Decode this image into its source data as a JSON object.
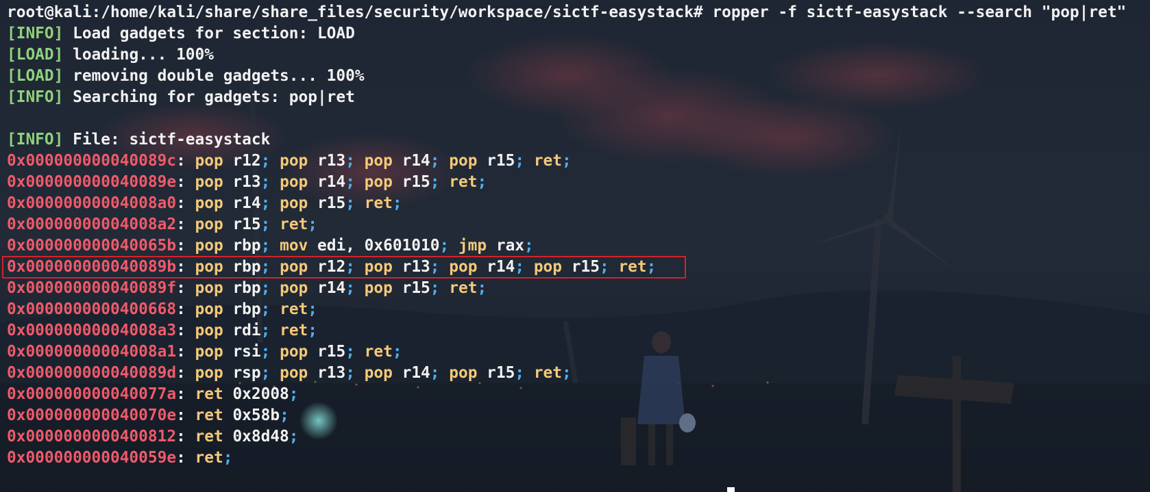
{
  "terminal": {
    "prompt": "root@kali:/home/kali/share/share_files/security/workspace/sictf-easystack#",
    "command": "ropper -f sictf-easystack --search \"pop|ret\"",
    "log": [
      {
        "tag": "[INFO]",
        "message": "Load gadgets for section: LOAD"
      },
      {
        "tag": "[LOAD]",
        "message": "loading... 100%"
      },
      {
        "tag": "[LOAD]",
        "message": "removing double gadgets... 100%"
      },
      {
        "tag": "[INFO]",
        "message": "Searching for gadgets: pop|ret"
      }
    ],
    "file_info": {
      "tag": "[INFO]",
      "message": "File: sictf-easystack"
    },
    "gadgets": [
      {
        "addr": "0x000000000040089c",
        "instrs": [
          [
            "pop",
            "r12"
          ],
          [
            "pop",
            "r13"
          ],
          [
            "pop",
            "r14"
          ],
          [
            "pop",
            "r15"
          ],
          [
            "ret",
            ""
          ]
        ]
      },
      {
        "addr": "0x000000000040089e",
        "instrs": [
          [
            "pop",
            "r13"
          ],
          [
            "pop",
            "r14"
          ],
          [
            "pop",
            "r15"
          ],
          [
            "ret",
            ""
          ]
        ]
      },
      {
        "addr": "0x00000000004008a0",
        "instrs": [
          [
            "pop",
            "r14"
          ],
          [
            "pop",
            "r15"
          ],
          [
            "ret",
            ""
          ]
        ]
      },
      {
        "addr": "0x00000000004008a2",
        "instrs": [
          [
            "pop",
            "r15"
          ],
          [
            "ret",
            ""
          ]
        ]
      },
      {
        "addr": "0x000000000040065b",
        "instrs": [
          [
            "pop",
            "rbp"
          ],
          [
            "mov",
            "edi, 0x601010"
          ],
          [
            "jmp",
            "rax"
          ]
        ]
      },
      {
        "addr": "0x000000000040089b",
        "instrs": [
          [
            "pop",
            "rbp"
          ],
          [
            "pop",
            "r12"
          ],
          [
            "pop",
            "r13"
          ],
          [
            "pop",
            "r14"
          ],
          [
            "pop",
            "r15"
          ],
          [
            "ret",
            ""
          ]
        ]
      },
      {
        "addr": "0x000000000040089f",
        "instrs": [
          [
            "pop",
            "rbp"
          ],
          [
            "pop",
            "r14"
          ],
          [
            "pop",
            "r15"
          ],
          [
            "ret",
            ""
          ]
        ]
      },
      {
        "addr": "0x0000000000400668",
        "instrs": [
          [
            "pop",
            "rbp"
          ],
          [
            "ret",
            ""
          ]
        ]
      },
      {
        "addr": "0x00000000004008a3",
        "instrs": [
          [
            "pop",
            "rdi"
          ],
          [
            "ret",
            ""
          ]
        ]
      },
      {
        "addr": "0x00000000004008a1",
        "instrs": [
          [
            "pop",
            "rsi"
          ],
          [
            "pop",
            "r15"
          ],
          [
            "ret",
            ""
          ]
        ]
      },
      {
        "addr": "0x000000000040089d",
        "instrs": [
          [
            "pop",
            "rsp"
          ],
          [
            "pop",
            "r13"
          ],
          [
            "pop",
            "r14"
          ],
          [
            "pop",
            "r15"
          ],
          [
            "ret",
            ""
          ]
        ]
      },
      {
        "addr": "0x000000000040077a",
        "instrs": [
          [
            "ret",
            "0x2008"
          ]
        ]
      },
      {
        "addr": "0x000000000040070e",
        "instrs": [
          [
            "ret",
            "0x58b"
          ]
        ]
      },
      {
        "addr": "0x0000000000400812",
        "instrs": [
          [
            "ret",
            "0x8d48"
          ]
        ]
      },
      {
        "addr": "0x000000000040059e",
        "instrs": [
          [
            "ret",
            ""
          ]
        ]
      }
    ],
    "highlighted_gadget_index": 5
  },
  "colors": {
    "tag": "#8fd17c",
    "address": "#f05a6a",
    "mnemonic": "#f4c979",
    "semicolon": "#4fb0f0",
    "text": "#f2f2f2",
    "highlight_border": "#d3232a"
  }
}
